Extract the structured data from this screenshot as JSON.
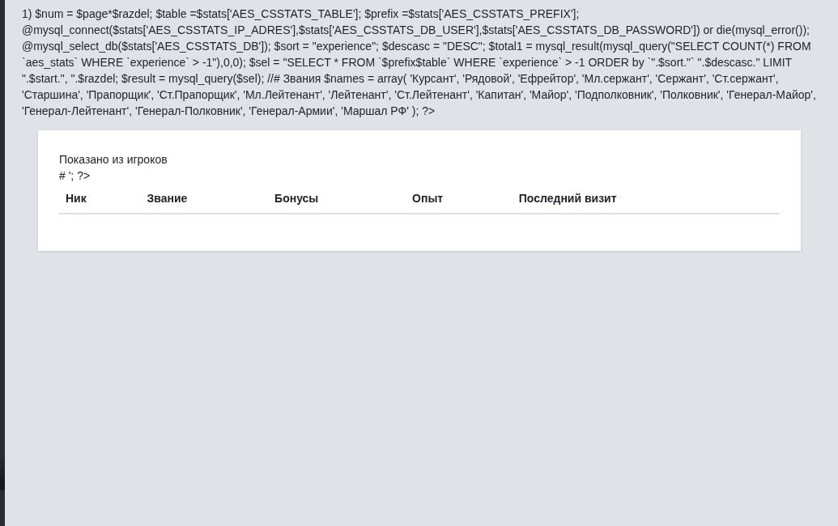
{
  "code_text": "1) $num = $page*$razdel; $table =$stats['AES_CSSTATS_TABLE']; $prefix =$stats['AES_CSSTATS_PREFIX']; @mysql_connect($stats['AES_CSSTATS_IP_ADRES'],$stats['AES_CSSTATS_DB_USER'],$stats['AES_CSSTATS_DB_PASSWORD']) or die(mysql_error()); @mysql_select_db($stats['AES_CSSTATS_DB']); $sort = \"experience\"; $descasc = \"DESC\"; $total1 = mysql_result(mysql_query(\"SELECT COUNT(*) FROM `aes_stats` WHERE `experience` > -1\"),0,0); $sel = \"SELECT * FROM `$prefix$table` WHERE `experience` > -1 ORDER by `\".$sort.\"` \".$descasc.\" LIMIT \".$start.\", \".$razdel; $result = mysql_query($sel); //# Звания $names = array( 'Курсант', 'Рядовой', 'Ефрейтор', 'Мл.сержант', 'Сержант', 'Ст.сержант', 'Старшина', 'Прапорщик', 'Ст.Прапорщик', 'Мл.Лейтенант', 'Лейтенант', 'Ст.Лейтенант', 'Капитан', 'Майор', 'Подполковник', 'Полковник', 'Генерал-Майор', 'Генерал-Лейтенант', 'Генерал-Полковник', 'Генерал-Армии', 'Маршал РФ' ); ?>",
  "panel": {
    "summary": "Показано из игроков",
    "code_fragment": "# '; ?>",
    "table": {
      "columns": [
        "Ник",
        "Звание",
        "Бонусы",
        "Опыт",
        "Последний визит"
      ]
    }
  }
}
